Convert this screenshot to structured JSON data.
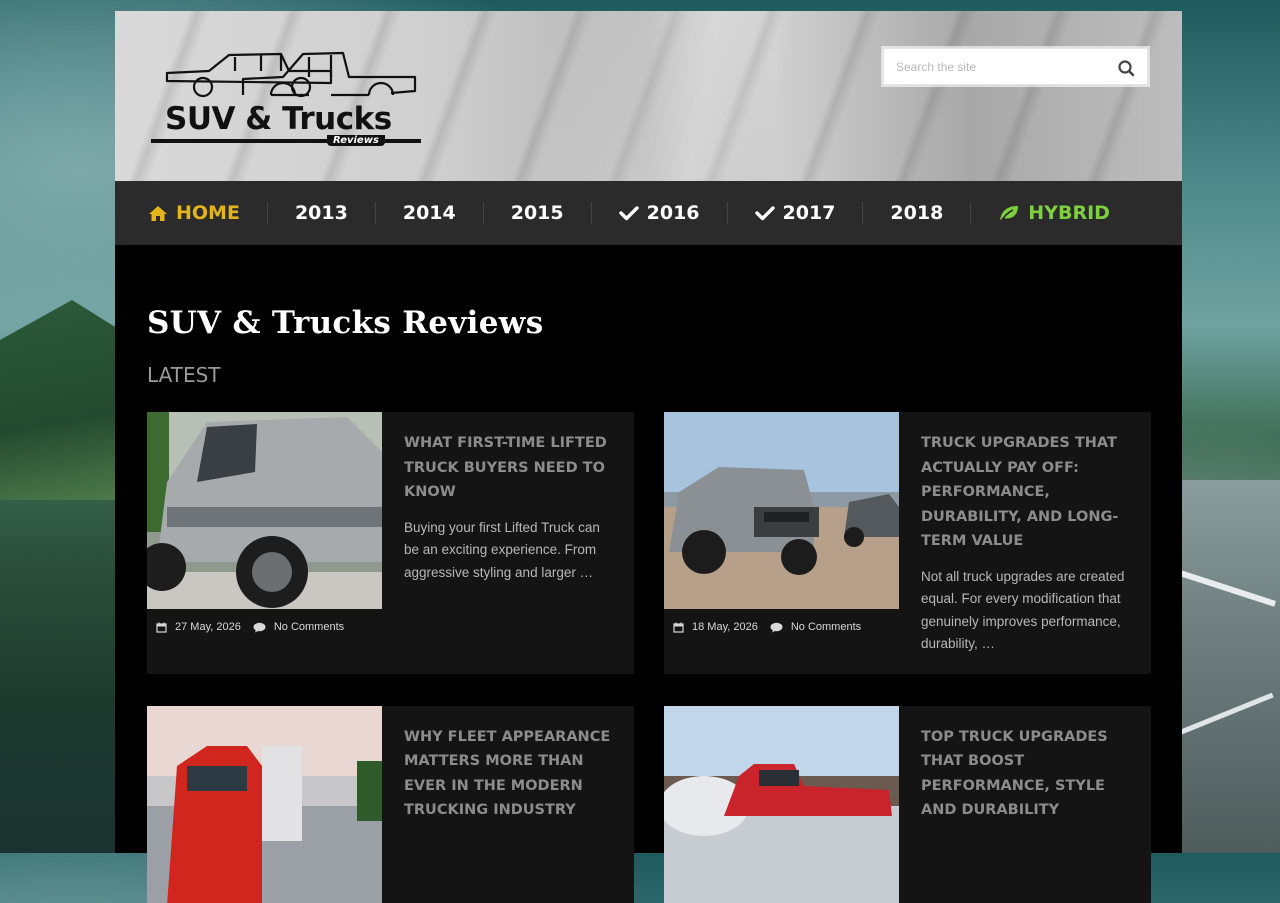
{
  "header": {
    "logo_title": "SUV & Trucks",
    "logo_subtitle": "Reviews",
    "search_placeholder": "Search the site"
  },
  "nav": {
    "items": [
      {
        "label": "HOME",
        "icon": "home-icon",
        "color": "#e4b41c"
      },
      {
        "label": "2013"
      },
      {
        "label": "2014"
      },
      {
        "label": "2015"
      },
      {
        "label": "2016",
        "icon": "check-icon"
      },
      {
        "label": "2017",
        "icon": "check-icon"
      },
      {
        "label": "2018"
      },
      {
        "label": "HYBRID",
        "icon": "leaf-icon",
        "color": "#7ed03f"
      }
    ]
  },
  "main": {
    "site_title": "SUV & Trucks Reviews",
    "section_label": "LATEST",
    "posts": [
      {
        "title": "What First-Time Lifted Truck Buyers Need to Know",
        "excerpt": "Buying your first Lifted Truck can be an exciting experience. From aggressive styling and larger …",
        "date": "27 May, 2026",
        "comments": "No Comments"
      },
      {
        "title": "Truck Upgrades That Actually Pay Off: Performance, Durability, and Long-Term Value",
        "excerpt": "Not all truck upgrades are created equal. For every modification that genuinely improves performance, durability, …",
        "date": "18 May, 2026",
        "comments": "No Comments"
      },
      {
        "title": "Why Fleet Appearance Matters More Than Ever in the Modern Trucking Industry",
        "excerpt": "",
        "date": "",
        "comments": ""
      },
      {
        "title": "Top Truck Upgrades That Boost Performance, Style and Durability",
        "excerpt": "",
        "date": "",
        "comments": ""
      }
    ]
  }
}
